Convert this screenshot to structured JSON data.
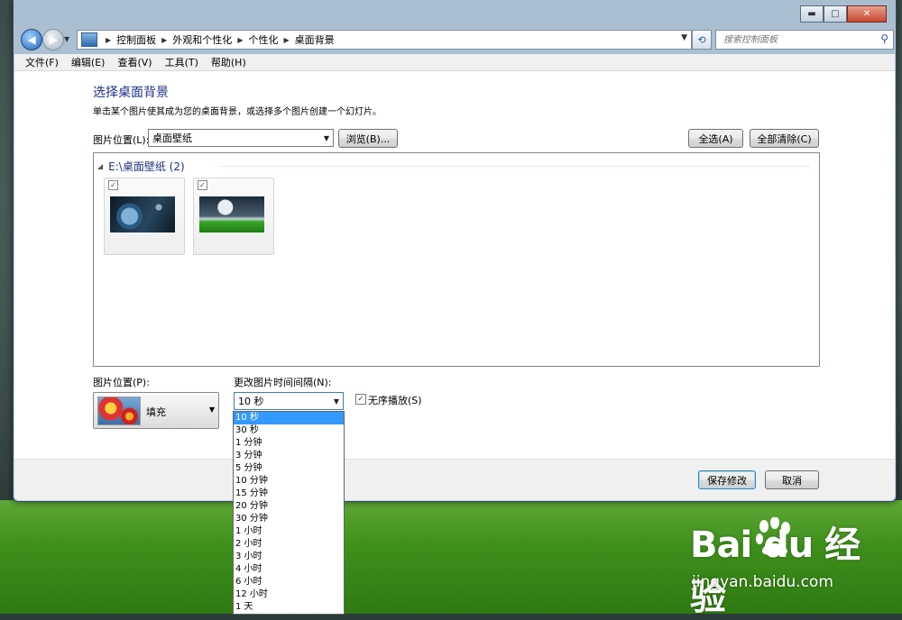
{
  "window": {
    "caption_buttons": {
      "minimize": "▬",
      "maximize": "□",
      "close": "✕"
    }
  },
  "navbar": {
    "back_icon": "◀",
    "forward_icon": "▶",
    "breadcrumbs": [
      "控制面板",
      "外观和个性化",
      "个性化",
      "桌面背景"
    ],
    "search_placeholder": "搜索控制面板"
  },
  "menu": {
    "items": [
      "文件(F)",
      "编辑(E)",
      "查看(V)",
      "工具(T)",
      "帮助(H)"
    ]
  },
  "main": {
    "title": "选择桌面背景",
    "description": "单击某个图片使其成为您的桌面背景，或选择多个图片创建一个幻灯片。",
    "location_label": "图片位置(L):",
    "location_value": "桌面壁纸",
    "browse_button": "浏览(B)...",
    "select_all_button": "全选(A)",
    "clear_all_button": "全部清除(C)",
    "gallery": {
      "group_title": "E:\\桌面壁纸 (2)",
      "thumbnails": [
        {
          "checked": true,
          "name": "planet-wallpaper"
        },
        {
          "checked": true,
          "name": "moon-landscape-wallpaper"
        }
      ]
    },
    "position_label": "图片位置(P):",
    "position_value": "填充",
    "interval_label": "更改图片时间间隔(N):",
    "interval_value": "10 秒",
    "shuffle_label": "无序播放(S)",
    "shuffle_checked": true,
    "interval_options": [
      "10 秒",
      "30 秒",
      "1 分钟",
      "3 分钟",
      "5 分钟",
      "10 分钟",
      "15 分钟",
      "20 分钟",
      "30 分钟",
      "1 小时",
      "2 小时",
      "3 小时",
      "4 小时",
      "6 小时",
      "12 小时",
      "1 天"
    ],
    "interval_selected_index": 0
  },
  "footer": {
    "save_button": "保存修改",
    "cancel_button": "取消"
  },
  "watermark": {
    "logo": "Bai du 经验",
    "url": "jingyan.baidu.com"
  },
  "colors": {
    "title": "#1e3287",
    "selection": "#3399ff"
  }
}
